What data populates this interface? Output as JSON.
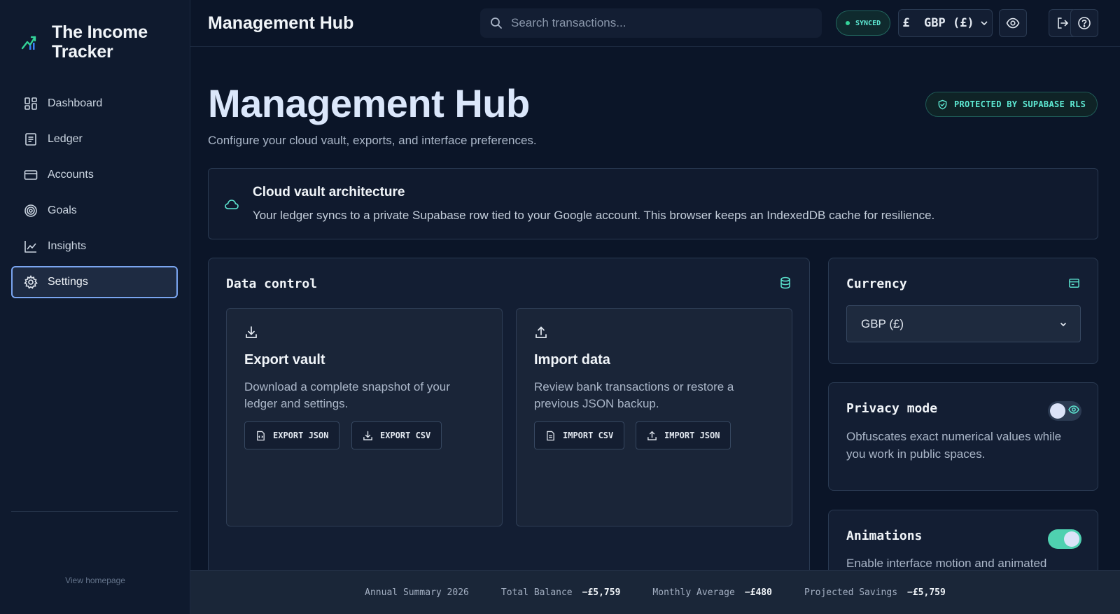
{
  "app": {
    "brand_line1": "The Income",
    "brand_line2": "Tracker"
  },
  "sidebar": {
    "items": [
      {
        "label": "Dashboard",
        "icon": "dashboard-icon"
      },
      {
        "label": "Ledger",
        "icon": "ledger-icon"
      },
      {
        "label": "Accounts",
        "icon": "card-icon"
      },
      {
        "label": "Goals",
        "icon": "target-icon"
      },
      {
        "label": "Insights",
        "icon": "chart-line-icon"
      },
      {
        "label": "Settings",
        "icon": "gear-icon",
        "active": true
      }
    ],
    "homepage_link": "View homepage"
  },
  "header": {
    "title": "Management Hub",
    "search_placeholder": "Search transactions...",
    "sync_status": "SYNCED",
    "currency": "£  GBP (£)"
  },
  "page": {
    "title": "Management Hub",
    "subtitle": "Configure your cloud vault, exports, and interface preferences.",
    "rls_badge": "PROTECTED BY SUPABASE RLS"
  },
  "vault": {
    "title": "Cloud vault architecture",
    "description": "Your ledger syncs to a private Supabase row tied to your Google account. This browser keeps an IndexedDB cache for resilience."
  },
  "data_control": {
    "title": "Data control",
    "export": {
      "title": "Export vault",
      "description": "Download a complete snapshot of your ledger and settings.",
      "btn_json": "EXPORT JSON",
      "btn_csv": "EXPORT CSV"
    },
    "import": {
      "title": "Import data",
      "description": "Review bank transactions or restore a previous JSON backup.",
      "btn_csv": "IMPORT CSV",
      "btn_json": "IMPORT JSON"
    }
  },
  "currency_card": {
    "title": "Currency",
    "selected": "GBP (£)"
  },
  "privacy_card": {
    "title": "Privacy mode",
    "description": "Obfuscates exact numerical values while you work in public spaces.",
    "enabled": false
  },
  "animations_card": {
    "title": "Animations",
    "description": "Enable interface motion and animated",
    "enabled": true
  },
  "footer": {
    "summary_label": "Annual Summary 2026",
    "total_balance_label": "Total Balance",
    "total_balance_value": "−£5,759",
    "monthly_average_label": "Monthly Average",
    "monthly_average_value": "−£480",
    "projected_savings_label": "Projected Savings",
    "projected_savings_value": "−£5,759"
  },
  "colors": {
    "accent_teal": "#5eead4",
    "active_border": "#7aa5f0",
    "background": "#0b1528"
  }
}
